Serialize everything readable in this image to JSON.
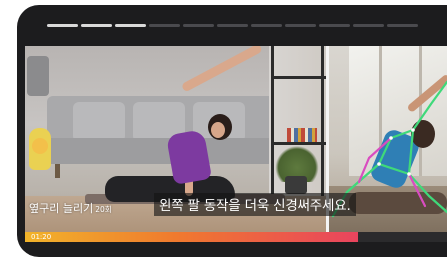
{
  "story_progress": {
    "segments_total": 11,
    "segments_done": 3
  },
  "video": {
    "subtitle": "왼쪽 팔 동작을 더욱 신경써주세요.",
    "program": {
      "title": "옆구리 늘리기",
      "count": "20회"
    },
    "timer": {
      "elapsed": "01:20",
      "progress": 0.79
    }
  },
  "colors": {
    "progress_start": "#f1b32a",
    "progress_end": "#e9445e",
    "pose_skeleton": "#3fd97a",
    "pose_accent": "#d94cc0"
  },
  "icons": {
    "pose_overlay": "pose-skeleton-icon"
  }
}
